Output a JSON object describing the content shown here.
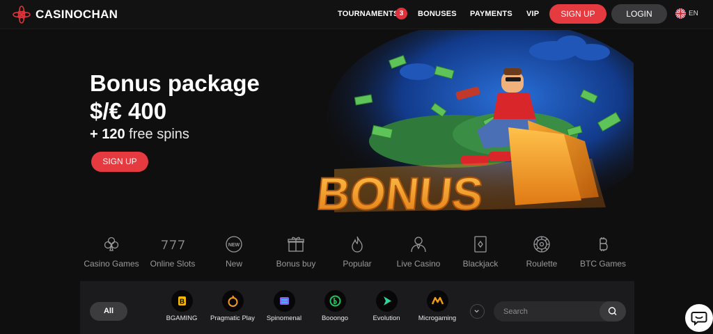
{
  "header": {
    "brand": "CASINOCHAN",
    "nav": {
      "tournaments": "TOURNAMENTS",
      "tournaments_count": "3",
      "bonuses": "BONUSES",
      "payments": "PAYMENTS",
      "vip": "VIP"
    },
    "signup_label": "SIGN UP",
    "login_label": "LOGIN",
    "language": "EN"
  },
  "hero": {
    "title": "Bonus package",
    "amount": "$/€ 400",
    "spins_count": "+ 120",
    "spins_text": "free spins",
    "signup_label": "SIGN UP",
    "art_text": "BONUS"
  },
  "categories": [
    {
      "label": "Casino Games",
      "icon": "club-icon"
    },
    {
      "label": "Online Slots",
      "icon": "sevens-icon"
    },
    {
      "label": "New",
      "icon": "new-badge-icon"
    },
    {
      "label": "Bonus buy",
      "icon": "gift-box-icon"
    },
    {
      "label": "Popular",
      "icon": "flame-icon"
    },
    {
      "label": "Live Casino",
      "icon": "dealer-icon"
    },
    {
      "label": "Blackjack",
      "icon": "playing-card-icon"
    },
    {
      "label": "Roulette",
      "icon": "roulette-icon"
    },
    {
      "label": "BTC Games",
      "icon": "bitcoin-icon"
    }
  ],
  "providers": {
    "all_label": "All",
    "items": [
      {
        "name": "BGAMING"
      },
      {
        "name": "Pragmatic Play"
      },
      {
        "name": "Spinomenal"
      },
      {
        "name": "Booongo"
      },
      {
        "name": "Evolution"
      },
      {
        "name": "Microgaming"
      }
    ],
    "search_placeholder": "Search"
  },
  "colors": {
    "accent": "#e53a3f",
    "background": "#0f0f10",
    "panel": "#1b1b1d"
  }
}
